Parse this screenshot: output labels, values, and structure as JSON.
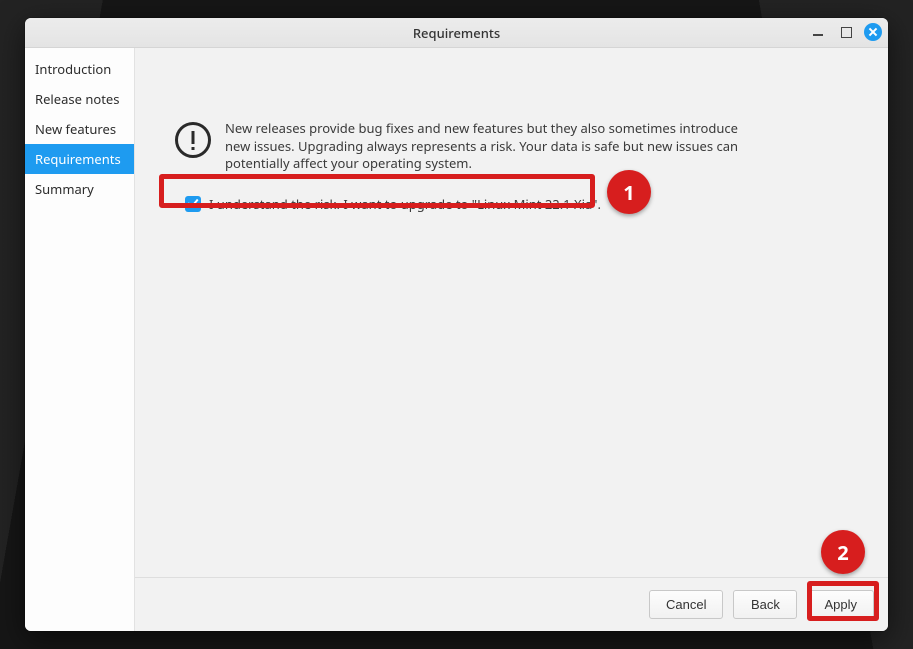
{
  "window": {
    "title": "Requirements"
  },
  "sidebar": {
    "items": [
      {
        "label": "Introduction"
      },
      {
        "label": "Release notes"
      },
      {
        "label": "New features"
      },
      {
        "label": "Requirements"
      },
      {
        "label": "Summary"
      }
    ],
    "active_index": 3
  },
  "content": {
    "warning_text": "New releases provide bug fixes and new features but they also sometimes introduce new issues. Upgrading always represents a risk. Your data is safe but new issues can potentially affect your operating system.",
    "checkbox_label": "I understand the risk. I want to upgrade to \"Linux Mint 22.1 Xia\".",
    "checkbox_checked": true
  },
  "footer": {
    "cancel": "Cancel",
    "back": "Back",
    "apply": "Apply"
  },
  "annotations": {
    "callout1": "1",
    "callout2": "2"
  }
}
